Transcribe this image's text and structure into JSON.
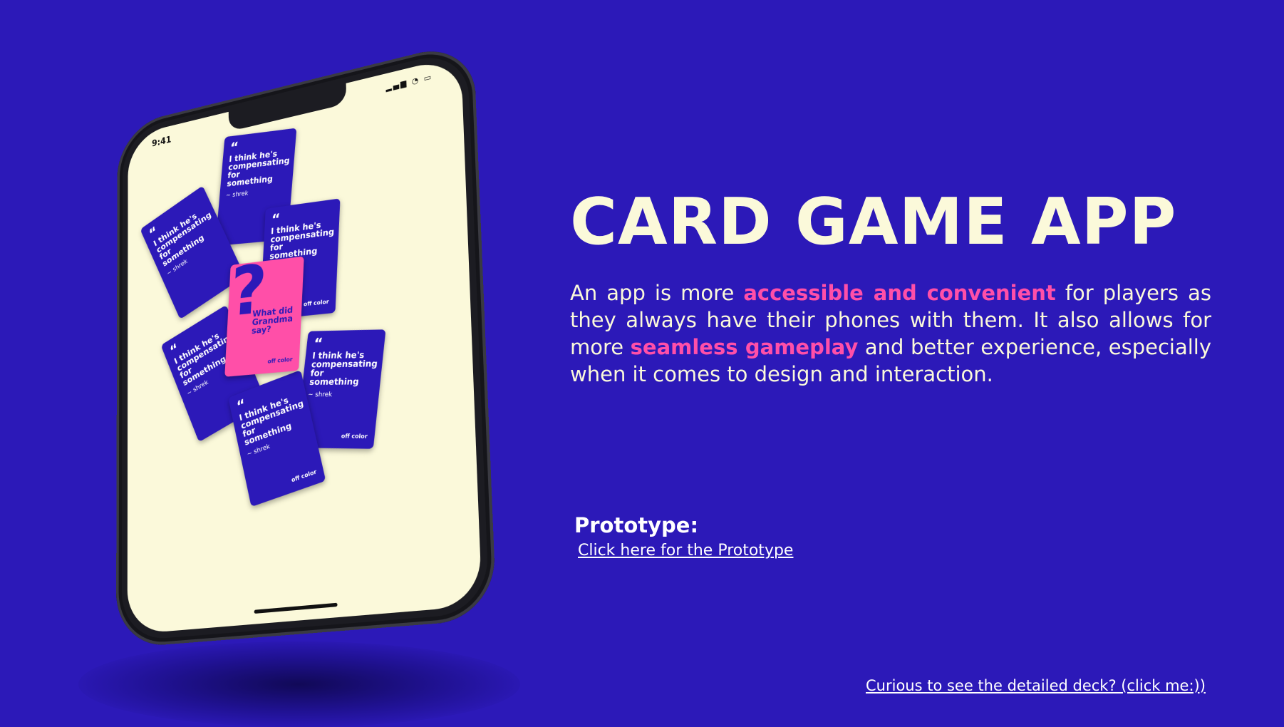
{
  "phone": {
    "status_time": "9:41",
    "status_icons": "▂▄▆ ◔ ▭",
    "card": {
      "quote_mark": "“",
      "text": "I think he's compensating for something",
      "author": "~ shrek",
      "brand": "off color"
    },
    "pink_card": {
      "symbol": "?",
      "text": "What did Grandma say?",
      "brand": "off color"
    }
  },
  "hero": {
    "title": "CARD GAME APP",
    "description_parts": {
      "p1": "An app is more ",
      "h1": "accessible and convenient",
      "p2": " for players as they always have their phones with them. It also allows for more ",
      "h2": "seamless gameplay",
      "p3": " and better experience, especially when it comes to design and interaction."
    }
  },
  "prototype": {
    "label": "Prototype:",
    "link_text": "Click here for the Prototype"
  },
  "deck_link_text": "Curious to see the detailed deck? (click me:))",
  "colors": {
    "background": "#2c19b8",
    "accent": "#ff4fa8",
    "cream": "#fbf9da"
  }
}
